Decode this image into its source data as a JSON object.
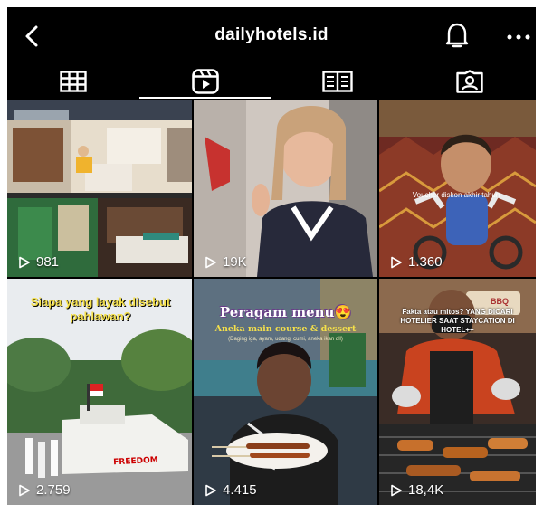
{
  "header": {
    "title": "dailyhotels.id",
    "back_icon": "chevron-left-icon",
    "notify_icon": "bell-icon",
    "menu_icon": "more-horizontal-icon"
  },
  "tabs": [
    {
      "name": "grid",
      "icon": "grid-icon"
    },
    {
      "name": "reels",
      "icon": "reels-icon",
      "active": true
    },
    {
      "name": "guides",
      "icon": "guide-book-icon"
    },
    {
      "name": "tagged",
      "icon": "tagged-user-icon"
    }
  ],
  "reels": [
    {
      "views": "981"
    },
    {
      "views": "19K"
    },
    {
      "views": "1.360",
      "caption": "Voucher diskon akhir tahun"
    },
    {
      "views": "2.759",
      "caption": "Siapa yang layak disebut pahlawan?",
      "sign": "FREEDOM"
    },
    {
      "views": "4.415",
      "caption": "Peragam menu😍",
      "subcaption": "Aneka main course & dessert",
      "detail": "(Daging iga, ayam, udang, cumi, aneka ikan dll)"
    },
    {
      "views": "18,4K",
      "caption": "Fakta atau mitos? YANG DICARI HOTELIER SAAT STAYCATION DI HOTEL++",
      "sign": "BBQ"
    }
  ],
  "colors": {
    "background": "#000000",
    "text": "#ffffff",
    "caption_yellow": "#f5e04a"
  }
}
